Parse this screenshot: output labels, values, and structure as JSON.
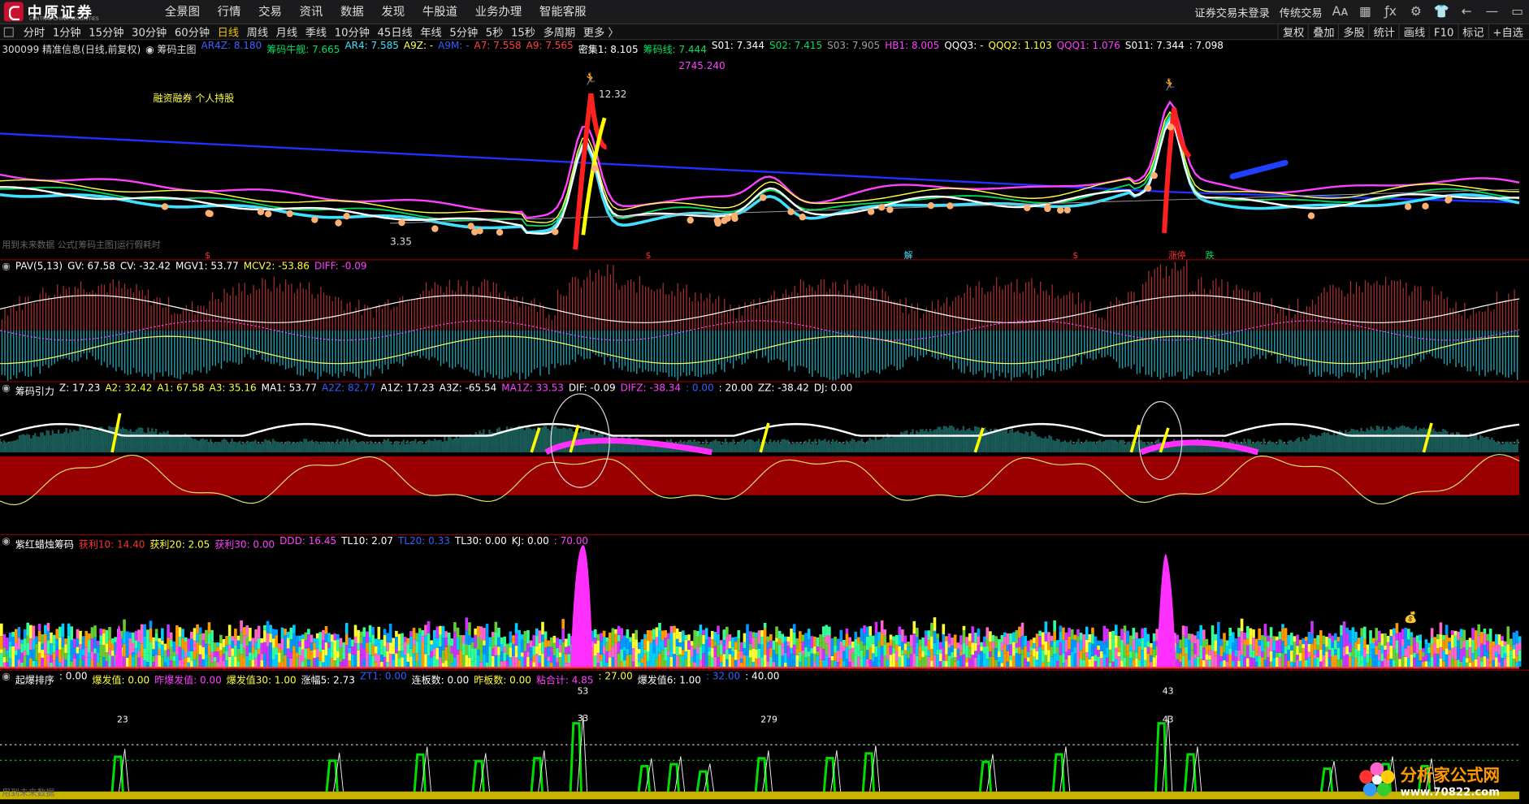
{
  "app": {
    "brand": "中原证券",
    "brand_sub": "CENTRAL CHINA SECURITIES",
    "menu": [
      "全景图",
      "行情",
      "交易",
      "资讯",
      "数据",
      "发现",
      "牛股道",
      "业务办理",
      "智能客服"
    ],
    "login_status": "证券交易未登录",
    "mode": "传统交易"
  },
  "periods": [
    "分时",
    "1分钟",
    "15分钟",
    "30分钟",
    "60分钟",
    "日线",
    "周线",
    "月线",
    "季线",
    "10分钟",
    "45日线",
    "年线",
    "5分钟",
    "5秒",
    "15秒",
    "多周期",
    "更多 〉"
  ],
  "active_period": "日线",
  "tools": [
    "复权",
    "叠加",
    "多股",
    "统计",
    "画线",
    "F10",
    "标记",
    "+自选"
  ],
  "main_panel": {
    "title": "300099 精准信息(日线,前复权)",
    "indicator": "筹码主图",
    "items": [
      {
        "t": "AR4Z: 8.180",
        "c": "#4060ff"
      },
      {
        "t": "筹码牛舰: 7.665",
        "c": "#00e060"
      },
      {
        "t": "AR4: 7.585",
        "c": "#40e0ff"
      },
      {
        "t": "A9Z: -",
        "c": "#ffff60"
      },
      {
        "t": "A9M: -",
        "c": "#3060ff"
      },
      {
        "t": "A7: 7.558",
        "c": "#ff4040"
      },
      {
        "t": "A9: 7.565",
        "c": "#ff4040"
      },
      {
        "t": "密集1: 8.105",
        "c": "#ffffff"
      },
      {
        "t": "筹码线: 7.444",
        "c": "#00e060"
      },
      {
        "t": "S01: 7.344",
        "c": "#ffffff"
      },
      {
        "t": "S02: 7.415",
        "c": "#00e060"
      },
      {
        "t": "S03: 7.905",
        "c": "#a0a0a0"
      },
      {
        "t": "HB1: 8.005",
        "c": "#ff40ff"
      },
      {
        "t": "QQQ3: -",
        "c": "#ffffff"
      },
      {
        "t": "QQQ2: 1.103",
        "c": "#ffff40"
      },
      {
        "t": "QQQ1: 1.076",
        "c": "#ff40ff"
      },
      {
        "t": "S011: 7.344",
        "c": "#ffffff"
      },
      {
        "t": ": 7.098",
        "c": "#ffffff"
      }
    ],
    "annotations": {
      "sub_title": "2745.240",
      "rzrq": "融资融券 个人持股",
      "high_label": "12.32",
      "low_label": "3.35",
      "future_note": "用到未来数据  公式[筹码主图]运行假耗时",
      "signals": [
        "$",
        "$",
        "解",
        "$",
        "涨停",
        "跌"
      ]
    }
  },
  "pav_panel": {
    "items": [
      {
        "t": "PAV(5,13)",
        "c": "#ffffff"
      },
      {
        "t": "GV: 67.58",
        "c": "#ffffff"
      },
      {
        "t": "CV: -32.42",
        "c": "#ffffff"
      },
      {
        "t": "MGV1: 53.77",
        "c": "#ffffff"
      },
      {
        "t": "MCV2: -53.86",
        "c": "#ffff40"
      },
      {
        "t": "DIFF: -0.09",
        "c": "#ff40ff"
      }
    ]
  },
  "chip_panel": {
    "items": [
      {
        "t": "筹码引力",
        "c": "#ffffff"
      },
      {
        "t": "Z: 17.23",
        "c": "#ffffff"
      },
      {
        "t": "A2: 32.42",
        "c": "#ffff40"
      },
      {
        "t": "A1: 67.58",
        "c": "#ffff40"
      },
      {
        "t": "A3: 35.16",
        "c": "#ffff40"
      },
      {
        "t": "MA1: 53.77",
        "c": "#ffffff"
      },
      {
        "t": "A2Z: 82.77",
        "c": "#3060ff"
      },
      {
        "t": "A1Z: 17.23",
        "c": "#ffffff"
      },
      {
        "t": "A3Z: -65.54",
        "c": "#ffffff"
      },
      {
        "t": "MA1Z: 33.53",
        "c": "#ff40ff"
      },
      {
        "t": "DIF: -0.09",
        "c": "#ffffff"
      },
      {
        "t": "DIFZ: -38.34",
        "c": "#ff40ff"
      },
      {
        "t": ": 0.00",
        "c": "#3060ff"
      },
      {
        "t": ": 20.00",
        "c": "#ffffff"
      },
      {
        "t": "ZZ: -38.42",
        "c": "#ffffff"
      },
      {
        "t": "DJ: 0.00",
        "c": "#ffffff"
      }
    ]
  },
  "purple_panel": {
    "items": [
      {
        "t": "紫红蜡烛筹码",
        "c": "#ffffff"
      },
      {
        "t": "获利10: 14.40",
        "c": "#ff3030"
      },
      {
        "t": "获利20: 2.05",
        "c": "#ffff40"
      },
      {
        "t": "获利30: 0.00",
        "c": "#ff40ff"
      },
      {
        "t": "DDD: 16.45",
        "c": "#ff40ff"
      },
      {
        "t": "TL10: 2.07",
        "c": "#ffffff"
      },
      {
        "t": "TL20: 0.33",
        "c": "#3060ff"
      },
      {
        "t": "TL30: 0.00",
        "c": "#ffffff"
      },
      {
        "t": "KJ: 0.00",
        "c": "#ffffff"
      },
      {
        "t": ": 70.00",
        "c": "#ff40ff"
      }
    ]
  },
  "burst_panel": {
    "items": [
      {
        "t": "起爆排序",
        "c": "#ffffff"
      },
      {
        "t": ": 0.00",
        "c": "#ffffff"
      },
      {
        "t": "爆发值: 0.00",
        "c": "#ffff40"
      },
      {
        "t": "昨爆发值: 0.00",
        "c": "#ff40ff"
      },
      {
        "t": "爆发值30: 1.00",
        "c": "#ffff40"
      },
      {
        "t": "涨幅5: 2.73",
        "c": "#ffffff"
      },
      {
        "t": "ZT1: 0.00",
        "c": "#3060ff"
      },
      {
        "t": "连板数: 0.00",
        "c": "#ffffff"
      },
      {
        "t": "昨板数: 0.00",
        "c": "#ffff40"
      },
      {
        "t": "粘合计: 4.85",
        "c": "#ff40ff"
      },
      {
        "t": ": 27.00",
        "c": "#ffff40"
      },
      {
        "t": "爆发值6: 1.00",
        "c": "#ffffff"
      },
      {
        "t": ": 32.00",
        "c": "#3060ff"
      },
      {
        "t": ": 40.00",
        "c": "#ffffff"
      }
    ],
    "labels": [
      "23",
      "53",
      "33",
      "279",
      "43"
    ],
    "future_note": "用到未来数据"
  },
  "watermark": {
    "site": "分析家公式网",
    "url": "www.70822.com"
  }
}
